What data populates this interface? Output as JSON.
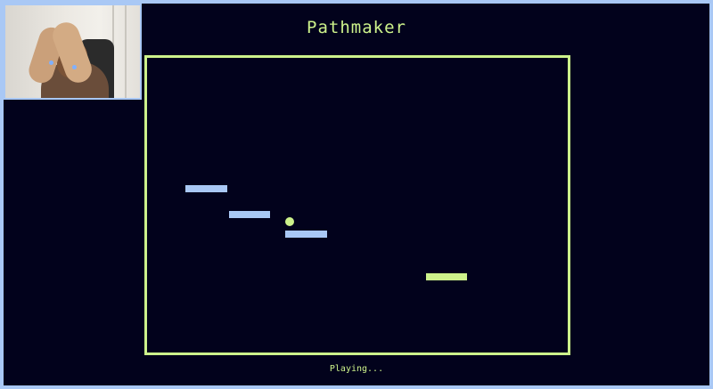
{
  "game": {
    "title": "Pathmaker",
    "status": "Playing..."
  },
  "webcam": {
    "label": "",
    "tracking_points": 2
  },
  "colors": {
    "background": "#02021c",
    "frame": "#a9c8f5",
    "accent": "#cdf28b",
    "platform_blue": "#a9c8f5",
    "platform_goal": "#cdf28b"
  },
  "scene": {
    "platforms": [
      {
        "type": "path"
      },
      {
        "type": "path"
      },
      {
        "type": "path"
      },
      {
        "type": "goal"
      }
    ],
    "ball": {
      "type": "player"
    }
  }
}
